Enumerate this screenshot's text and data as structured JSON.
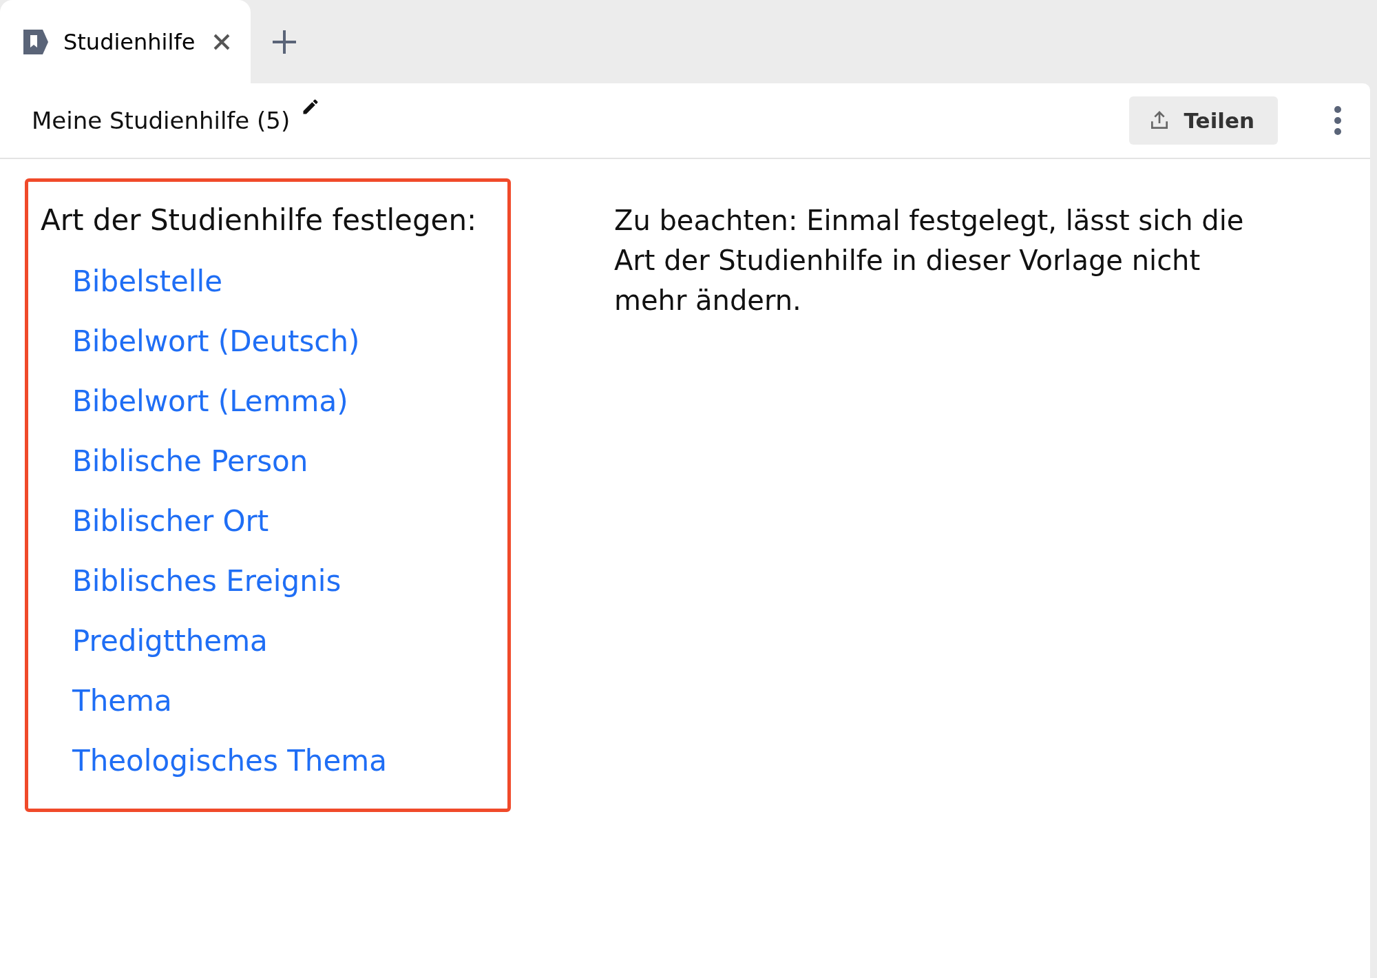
{
  "tabs": [
    {
      "label": "Studienhilfe",
      "selected": true
    }
  ],
  "toolbar": {
    "title": "Meine Studienhilfe (5)",
    "share_button": "Teilen"
  },
  "type_picker": {
    "heading": "Art der Studienhilfe festlegen:",
    "options": [
      "Bibelstelle",
      "Bibelwort (Deutsch)",
      "Bibelwort (Lemma)",
      "Biblische Person",
      "Biblischer Ort",
      "Biblisches Ereignis",
      "Predigtthema",
      "Thema",
      "Theologisches Thema"
    ]
  },
  "note": "Zu beachten: Einmal festgelegt, lässt sich die Art der Studienhilfe in dieser Vorlage nicht mehr ändern."
}
